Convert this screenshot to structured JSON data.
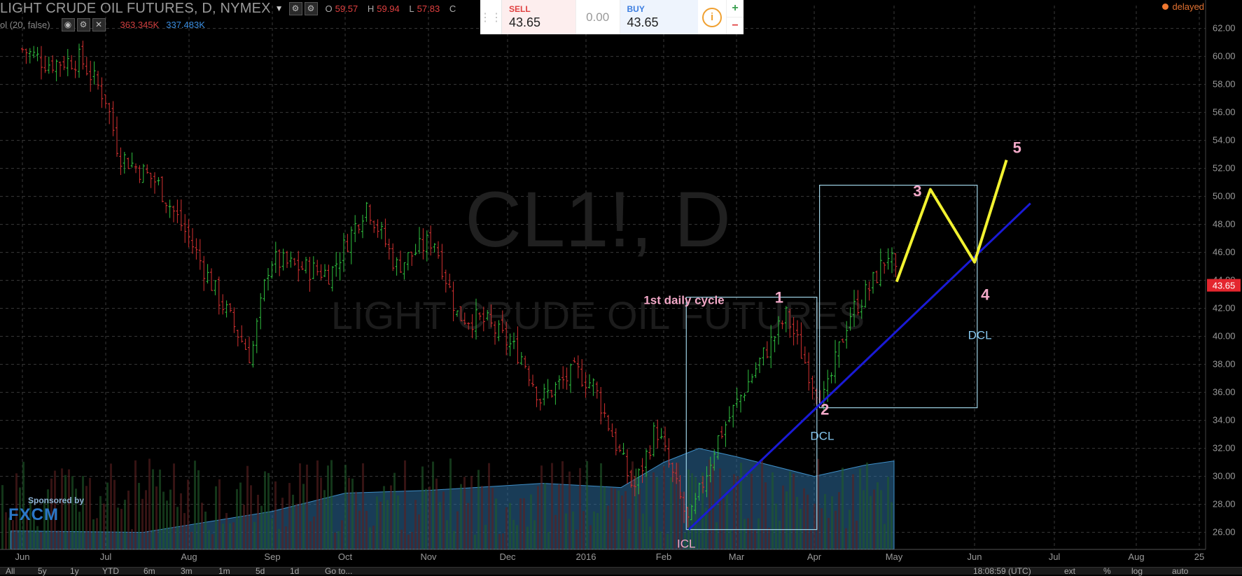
{
  "header": {
    "title": "LIGHT CRUDE OIL FUTURES, D, NYMEX",
    "open_label": "O",
    "open": "59.57",
    "high_label": "H",
    "high": "59.94",
    "low_label": "L",
    "low": "57.83",
    "close_label": "C"
  },
  "volume_row": {
    "label": "ol (20, false)",
    "v1": "363.345K",
    "v2": "337.483K"
  },
  "trade_panel": {
    "sell_label": "SELL",
    "sell_value": "43.65",
    "spread": "0.00",
    "buy_label": "BUY",
    "buy_value": "43.65",
    "info": "i",
    "plus": "+",
    "minus": "−"
  },
  "status": {
    "delayed": "delayed"
  },
  "sponsor": {
    "text": "Sponsored by",
    "brand": "FXCM"
  },
  "bottombar": {
    "items": [
      "All",
      "5y",
      "1y",
      "YTD",
      "6m",
      "3m",
      "1m",
      "5d",
      "1d",
      "Go to...",
      "18:08:59 (UTC)",
      "ext",
      "%",
      "log",
      "auto"
    ]
  },
  "colors": {
    "up": "#2fbf3f",
    "down": "#d23030",
    "trend": "#1a1ad6",
    "projection": "#f2f230",
    "box": "#9fd3e6",
    "wave_label": "#f3a9c8",
    "dcl_label": "#86c7ef",
    "volume": "#2e6e9e",
    "price_badge": "#e4262e"
  },
  "chart_data": {
    "type": "candlestick",
    "symbol": "CL1!, D",
    "watermark": "CL1!, D",
    "watermark_sub": "LIGHT CRUDE OIL FUTURES",
    "ylim": [
      25,
      62.5
    ],
    "y_ticks": [
      "26.00",
      "28.00",
      "30.00",
      "32.00",
      "34.00",
      "36.00",
      "38.00",
      "40.00",
      "42.00",
      "44.00",
      "46.00",
      "48.00",
      "50.00",
      "52.00",
      "54.00",
      "56.00",
      "58.00",
      "60.00",
      "62.00"
    ],
    "x_ticks": [
      "Jun",
      "Jul",
      "Aug",
      "Sep",
      "Oct",
      "Nov",
      "Dec",
      "2016",
      "Feb",
      "Mar",
      "Apr",
      "May",
      "Jun",
      "Jul",
      "Aug",
      "25"
    ],
    "last_price": "43.65",
    "price_path": [
      [
        "2015-06-01",
        60.5
      ],
      [
        "2015-06-10",
        59.5
      ],
      [
        "2015-06-22",
        59.8
      ],
      [
        "2015-07-01",
        57.0
      ],
      [
        "2015-07-06",
        53.0
      ],
      [
        "2015-07-20",
        51.0
      ],
      [
        "2015-08-01",
        47.0
      ],
      [
        "2015-08-10",
        43.5
      ],
      [
        "2015-08-24",
        38.5
      ],
      [
        "2015-08-31",
        45.5
      ],
      [
        "2015-09-10",
        45.0
      ],
      [
        "2015-09-25",
        44.5
      ],
      [
        "2015-10-09",
        49.5
      ],
      [
        "2015-10-20",
        45.0
      ],
      [
        "2015-11-03",
        47.0
      ],
      [
        "2015-11-12",
        41.5
      ],
      [
        "2015-11-23",
        41.0
      ],
      [
        "2015-12-07",
        38.5
      ],
      [
        "2015-12-14",
        35.5
      ],
      [
        "2015-12-28",
        37.5
      ],
      [
        "2016-01-04",
        36.5
      ],
      [
        "2016-01-20",
        29.0
      ],
      [
        "2016-01-29",
        33.5
      ],
      [
        "2016-02-11",
        26.5
      ],
      [
        "2016-02-22",
        32.5
      ],
      [
        "2016-03-08",
        37.5
      ],
      [
        "2016-03-21",
        41.5
      ],
      [
        "2016-04-01",
        36.5
      ],
      [
        "2016-04-05",
        35.5
      ],
      [
        "2016-04-14",
        41.5
      ],
      [
        "2016-04-22",
        43.5
      ],
      [
        "2016-04-29",
        46.0
      ],
      [
        "2016-05-02",
        44.0
      ]
    ],
    "volume_area": [
      [
        "2015-05-25",
        26.1
      ],
      [
        "2015-07-15",
        26.0
      ],
      [
        "2015-09-01",
        27.5
      ],
      [
        "2015-10-01",
        28.8
      ],
      [
        "2015-11-01",
        29.0
      ],
      [
        "2015-12-15",
        29.5
      ],
      [
        "2016-01-15",
        29.2
      ],
      [
        "2016-02-01",
        31.0
      ],
      [
        "2016-02-15",
        32.0
      ],
      [
        "2016-03-01",
        31.4
      ],
      [
        "2016-04-01",
        30.0
      ],
      [
        "2016-04-20",
        30.8
      ],
      [
        "2016-05-01",
        31.1
      ]
    ],
    "trendline": {
      "from": [
        "2016-02-11",
        26.2
      ],
      "to": [
        "2016-06-22",
        49.5
      ]
    },
    "projection": [
      [
        "2016-05-02",
        43.9
      ],
      [
        "2016-05-15",
        50.5
      ],
      [
        "2016-06-01",
        45.3
      ],
      [
        "2016-06-13",
        52.6
      ]
    ],
    "boxes": [
      {
        "from": [
          "2016-02-10",
          42.8
        ],
        "to": [
          "2016-04-02",
          26.2
        ]
      },
      {
        "from": [
          "2016-04-03",
          50.8
        ],
        "to": [
          "2016-06-02",
          34.9
        ]
      }
    ],
    "annotations": [
      {
        "text": "1st daily cycle",
        "at": [
          "2016-01-24",
          42.3
        ],
        "kind": "label"
      },
      {
        "text": "1",
        "at": [
          "2016-03-18",
          42.4
        ],
        "kind": "wave"
      },
      {
        "text": "2",
        "at": [
          "2016-04-05",
          34.4
        ],
        "kind": "wave"
      },
      {
        "text": "DCL",
        "at": [
          "2016-04-04",
          32.6
        ],
        "kind": "dcl"
      },
      {
        "text": "3",
        "at": [
          "2016-05-10",
          50.0
        ],
        "kind": "wave"
      },
      {
        "text": "4",
        "at": [
          "2016-06-05",
          42.6
        ],
        "kind": "wave"
      },
      {
        "text": "DCL",
        "at": [
          "2016-06-03",
          39.8
        ],
        "kind": "dcl"
      },
      {
        "text": "5",
        "at": [
          "2016-06-17",
          53.1
        ],
        "kind": "wave"
      },
      {
        "text": "ICL",
        "at": [
          "2016-02-10",
          24.9
        ],
        "kind": "dcl"
      }
    ]
  }
}
